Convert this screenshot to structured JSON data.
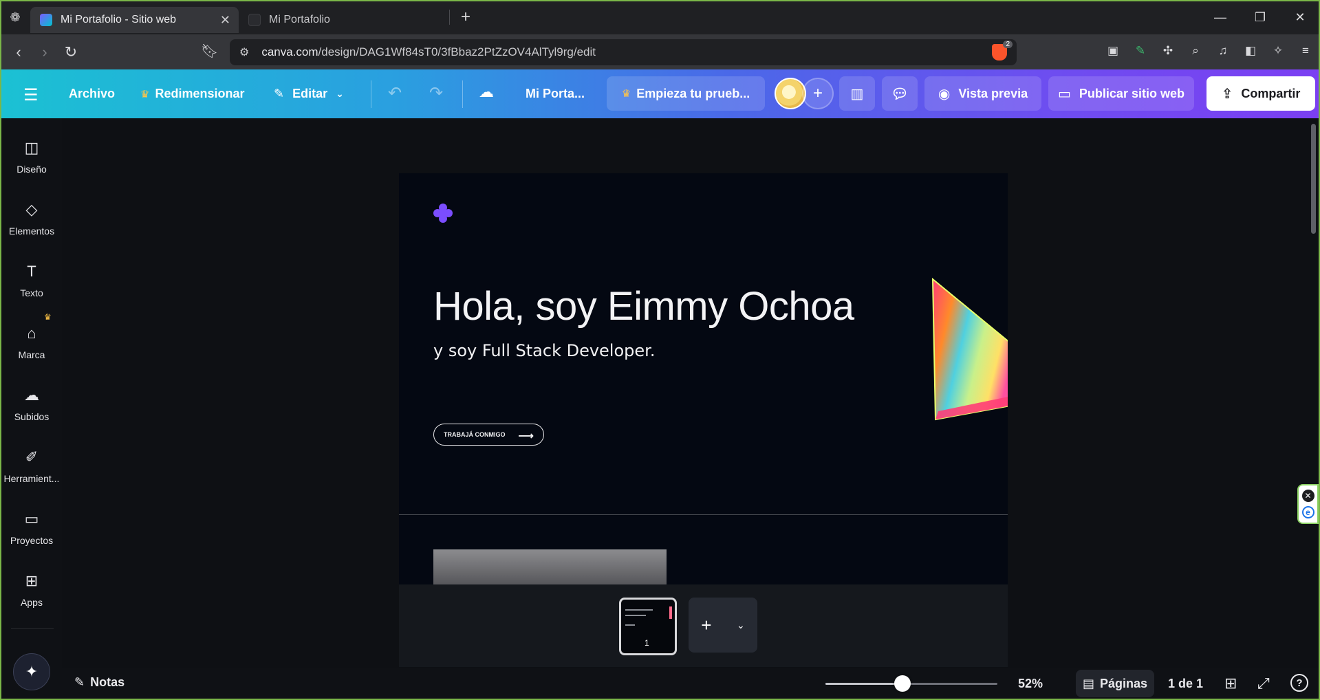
{
  "browser": {
    "tabs": [
      {
        "title": "Mi Portafolio - Sitio web",
        "active": true
      },
      {
        "title": "Mi Portafolio",
        "active": false
      }
    ],
    "url_host": "canva.com",
    "url_path": "/design/DAG1Wf84sT0/3fBbaz2PtZzOV4AlTyl9rg/edit",
    "extension_badge": "2",
    "window_controls": {
      "minimize": "—",
      "restore": "❐",
      "close": "✕"
    }
  },
  "toolbar": {
    "file_label": "Archivo",
    "resize_label": "Redimensionar",
    "edit_label": "Editar",
    "design_title": "Mi Porta...",
    "trial_label": "Empieza tu prueb...",
    "preview_label": "Vista previa",
    "publish_label": "Publicar sitio web",
    "share_label": "Compartir"
  },
  "sidebar": {
    "items": [
      {
        "label": "Diseño",
        "icon": "layout-icon"
      },
      {
        "label": "Elementos",
        "icon": "shapes-icon"
      },
      {
        "label": "Texto",
        "icon": "text-icon"
      },
      {
        "label": "Marca",
        "icon": "brand-icon"
      },
      {
        "label": "Subidos",
        "icon": "upload-cloud-icon"
      },
      {
        "label": "Herramient...",
        "icon": "draw-tool-icon"
      },
      {
        "label": "Proyectos",
        "icon": "folder-icon"
      },
      {
        "label": "Apps",
        "icon": "apps-grid-icon"
      }
    ]
  },
  "canvas": {
    "hero_title": "Hola, soy Eimmy Ochoa",
    "hero_subtitle": "y soy Full Stack Developer.",
    "cta_label": "TRABAJÁ CONMIGO",
    "accent_color": "#7b4dff"
  },
  "filmstrip": {
    "page_number": "1"
  },
  "statusbar": {
    "notes_label": "Notas",
    "zoom_percent": 52,
    "zoom_label": "52%",
    "pages_label": "Páginas",
    "page_count": "1 de 1"
  }
}
